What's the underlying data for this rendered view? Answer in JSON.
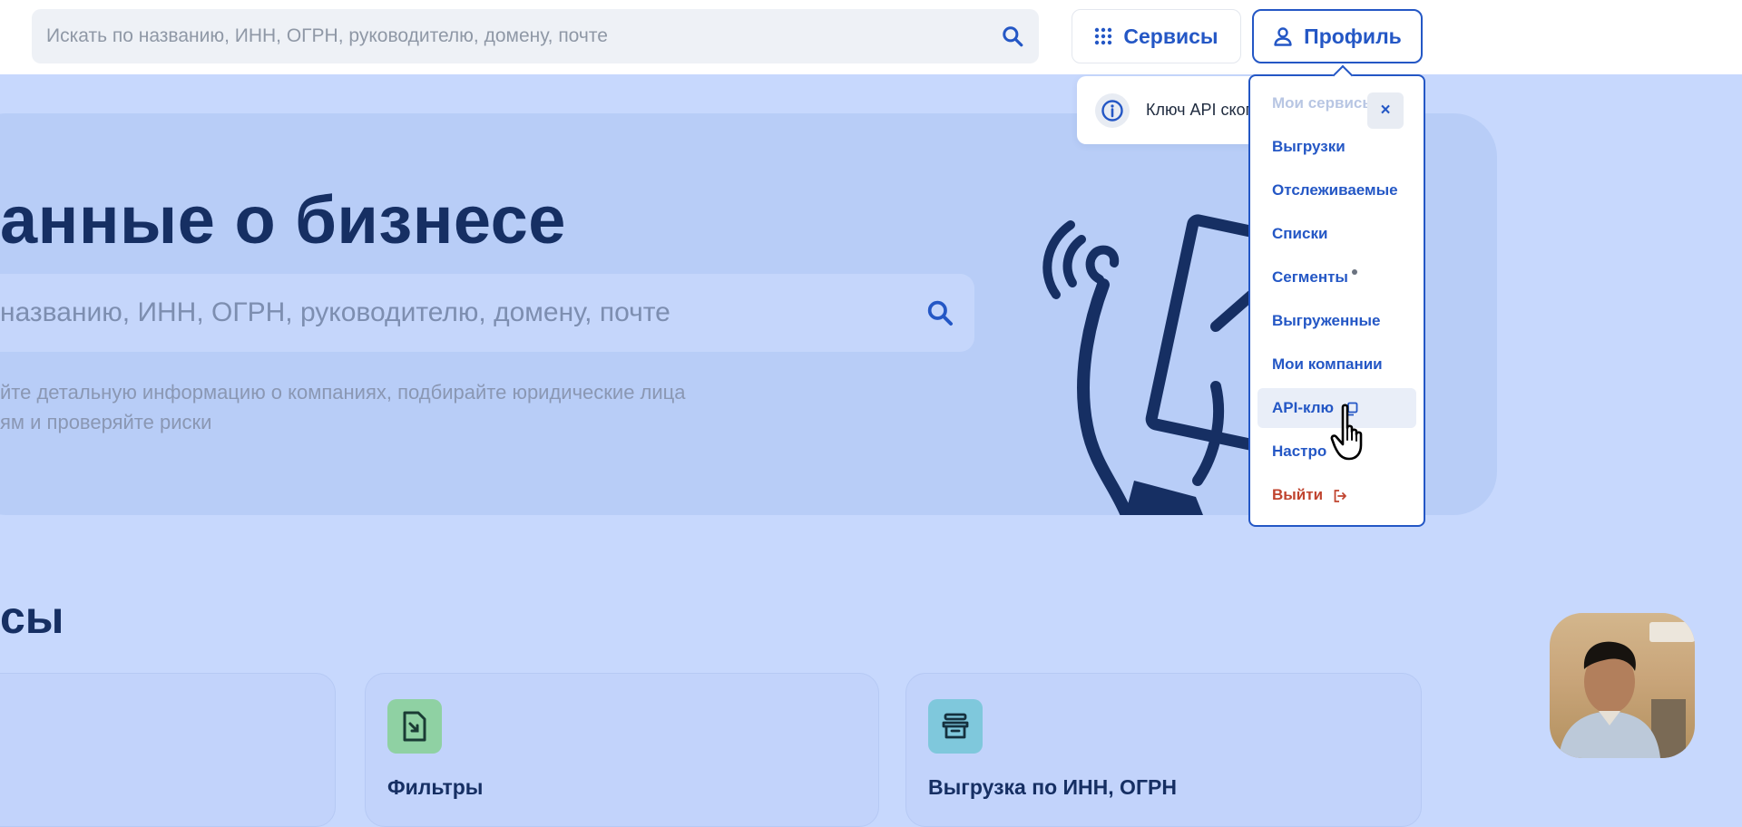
{
  "topbar": {
    "search_placeholder": "Искать по названию, ИНН, ОГРН, руководителю, домену, почте",
    "services_label": "Сервисы",
    "profile_label": "Профиль"
  },
  "hero": {
    "title": "анные о бизнесе",
    "search_placeholder": "названию, ИНН, ОГРН, руководителю, домену, почте",
    "description_line1": "йте детальную информацию о компаниях, подбирайте юридические лица",
    "description_line2": "ям и проверяйте риски"
  },
  "toast": {
    "message": "Ключ API скопирован",
    "close_label": "×"
  },
  "profile_menu": {
    "items": [
      {
        "label": "Мои сервисы"
      },
      {
        "label": "Выгрузки"
      },
      {
        "label": "Отслеживаемые"
      },
      {
        "label": "Списки"
      },
      {
        "label": "Сегменты"
      },
      {
        "label": "Выгруженные"
      },
      {
        "label": "Мои компании"
      },
      {
        "label": "API-клю"
      },
      {
        "label": "Настро"
      },
      {
        "label": "Выйти"
      }
    ]
  },
  "section": {
    "title": "сы",
    "cards": [
      {
        "label": ""
      },
      {
        "label": "Фильтры"
      },
      {
        "label": "Выгрузка по ИНН, ОГРН"
      }
    ]
  },
  "colors": {
    "accent": "#2457c5",
    "page_bg": "#c7d8fd",
    "hero_bg": "#b8cdf7",
    "title_dark": "#162f63",
    "logout": "#c0442f"
  },
  "icons": {
    "search": "search-icon",
    "services": "grid-icon",
    "profile": "user-icon",
    "info": "info-icon",
    "copy": "copy-icon",
    "logout": "logout-icon",
    "cursor": "hand-cursor-icon"
  }
}
